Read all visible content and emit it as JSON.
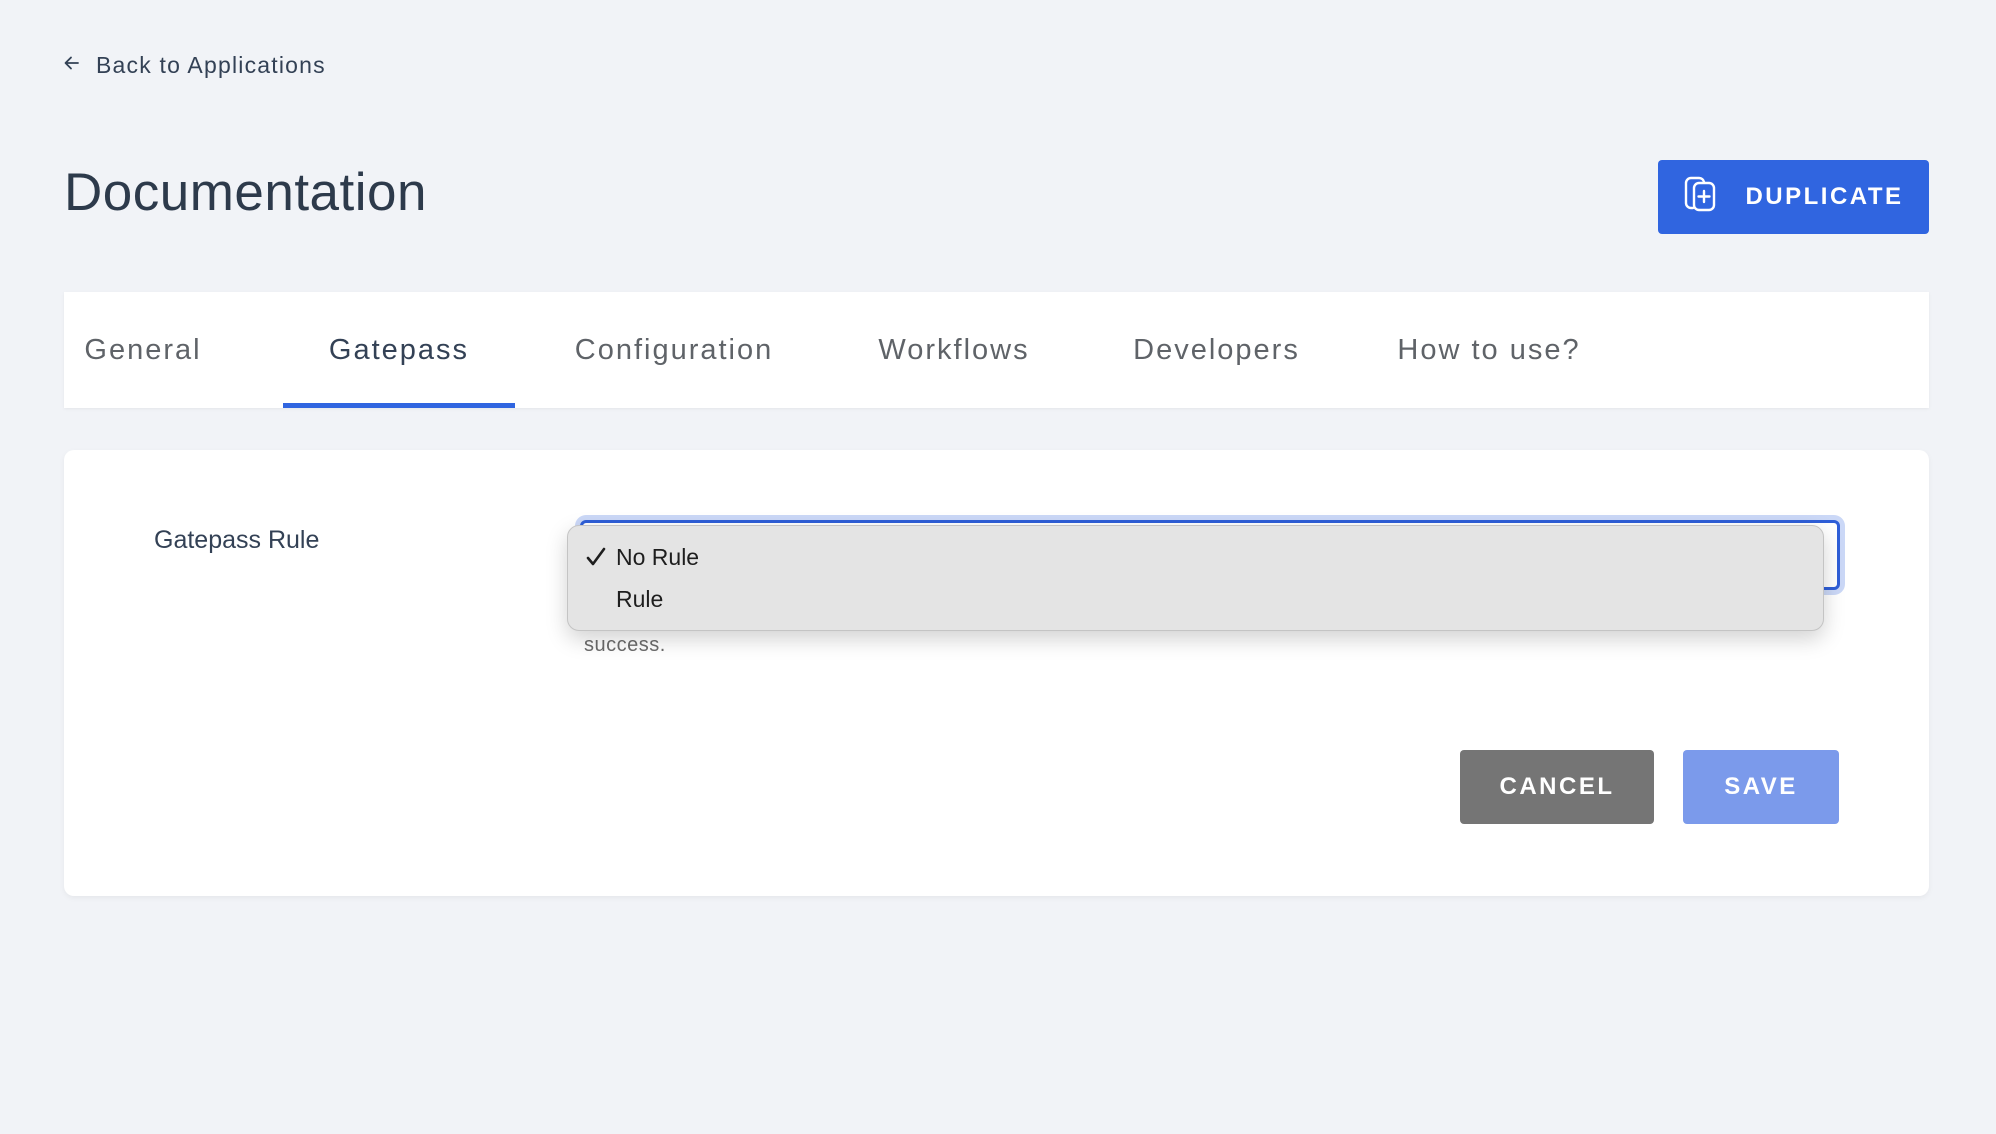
{
  "nav": {
    "back_label": "Back to Applications",
    "back_icon": "arrow-left-icon"
  },
  "header": {
    "title": "Documentation",
    "duplicate_label": "DUPLICATE",
    "duplicate_icon": "copy-plus-icon"
  },
  "tabs": [
    {
      "label": "General",
      "active": false
    },
    {
      "label": "Gatepass",
      "active": true
    },
    {
      "label": "Configuration",
      "active": false
    },
    {
      "label": "Workflows",
      "active": false
    },
    {
      "label": "Developers",
      "active": false
    },
    {
      "label": "How to use?",
      "active": false
    }
  ],
  "form": {
    "field_label": "Gatepass Rule",
    "select": {
      "selected": "No Rule",
      "options": [
        "No Rule",
        "Rule"
      ],
      "open": true
    },
    "helper_text_visible": "success.",
    "cancel_label": "CANCEL",
    "save_label": "SAVE"
  },
  "colors": {
    "accent": "#3065e0",
    "save_disabled": "#7b9aeb",
    "cancel": "#757575",
    "background": "#f1f3f7"
  }
}
